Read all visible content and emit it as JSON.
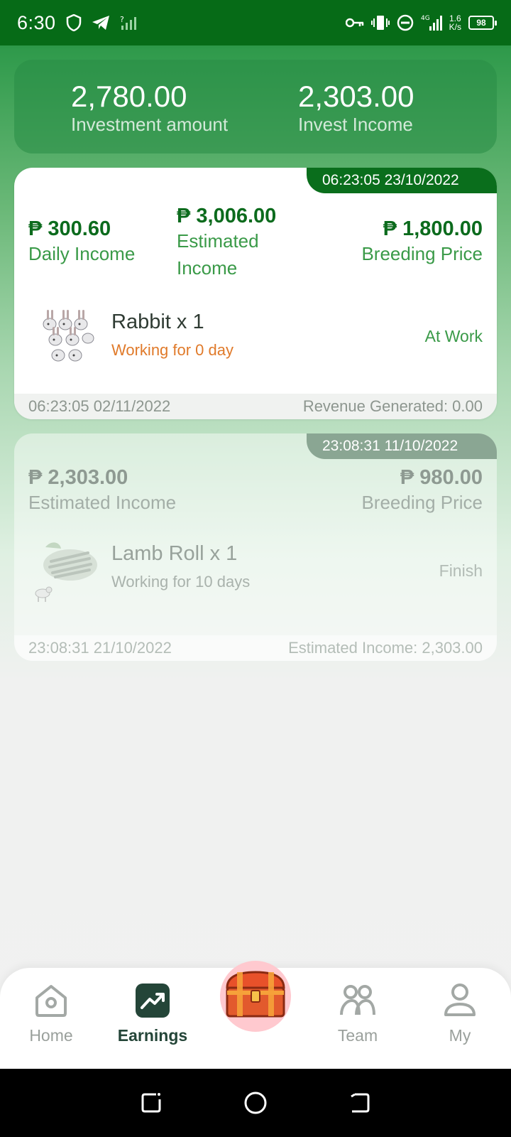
{
  "status_bar": {
    "time": "6:30",
    "network_label": "4G",
    "net_speed_value": "1.6",
    "net_speed_unit": "K/s",
    "battery": "98"
  },
  "summary": {
    "investment_amount": "2,780.00",
    "investment_amount_label": "Investment amount",
    "invest_income": "2,303.00",
    "invest_income_label": "Invest Income"
  },
  "orders": [
    {
      "timestamp": "06:23:05 23/10/2022",
      "daily_income": "₱ 300.60",
      "daily_income_label": "Daily Income",
      "estimated_income": "₱ 3,006.00",
      "estimated_income_label_line1": "Estimated",
      "estimated_income_label_line2": "Income",
      "breeding_price": "₱ 1,800.00",
      "breeding_price_label": "Breeding Price",
      "product_name": "Rabbit x 1",
      "working_status": "Working for 0 day",
      "state": "At Work",
      "footer_date": "06:23:05 02/11/2022",
      "footer_info": "Revenue Generated: 0.00"
    },
    {
      "timestamp": "23:08:31 11/10/2022",
      "estimated_income": "₱ 2,303.00",
      "estimated_income_label": "Estimated Income",
      "breeding_price": "₱ 980.00",
      "breeding_price_label": "Breeding Price",
      "product_name": "Lamb Roll x 1",
      "working_status": "Working for 10 days",
      "state": "Finish",
      "footer_date": "23:08:31 21/10/2022",
      "footer_info": "Estimated Income: 2,303.00"
    }
  ],
  "bottom_nav": {
    "items": [
      {
        "label": "Home",
        "icon": "home-icon",
        "active": false
      },
      {
        "label": "Earnings",
        "icon": "earnings-icon",
        "active": true
      },
      {
        "label": "",
        "icon": "treasure-chest-icon",
        "active": false
      },
      {
        "label": "Team",
        "icon": "team-icon",
        "active": false
      },
      {
        "label": "My",
        "icon": "user-icon",
        "active": false
      }
    ]
  },
  "colors": {
    "brand_dark_green": "#066b17",
    "accent_green": "#3a9a48",
    "money_green": "#0c6b1d",
    "status_orange": "#e07a2a",
    "chest_bg": "#ffc9cf"
  }
}
